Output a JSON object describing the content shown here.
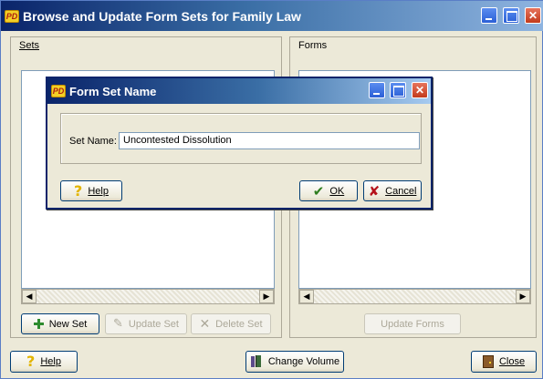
{
  "main_window": {
    "title": "Browse and Update Form Sets for Family Law"
  },
  "sets_panel": {
    "label": "Sets",
    "new_set": "New Set",
    "update_set": "Update Set",
    "delete_set": "Delete Set"
  },
  "forms_panel": {
    "label": "Forms",
    "update_forms": "Update Forms"
  },
  "footer": {
    "help": "Help",
    "change_volume": "Change Volume",
    "close": "Close"
  },
  "dialog": {
    "title": "Form Set Name",
    "set_name_label": "Set Name:",
    "set_name_value": "Uncontested Dissolution",
    "help": "Help",
    "ok": "OK",
    "cancel": "Cancel"
  },
  "icons": {
    "app": "pd-logo-icon",
    "help": "question-mark-icon",
    "new": "plus-icon",
    "update": "pencil-icon",
    "delete": "x-icon",
    "ok": "checkmark-icon",
    "cancel": "red-x-icon",
    "volume": "books-icon",
    "close": "door-icon"
  },
  "colors": {
    "titlebar_start": "#0a246a",
    "titlebar_end": "#8fb4e0",
    "window_bg": "#ece9d8"
  }
}
